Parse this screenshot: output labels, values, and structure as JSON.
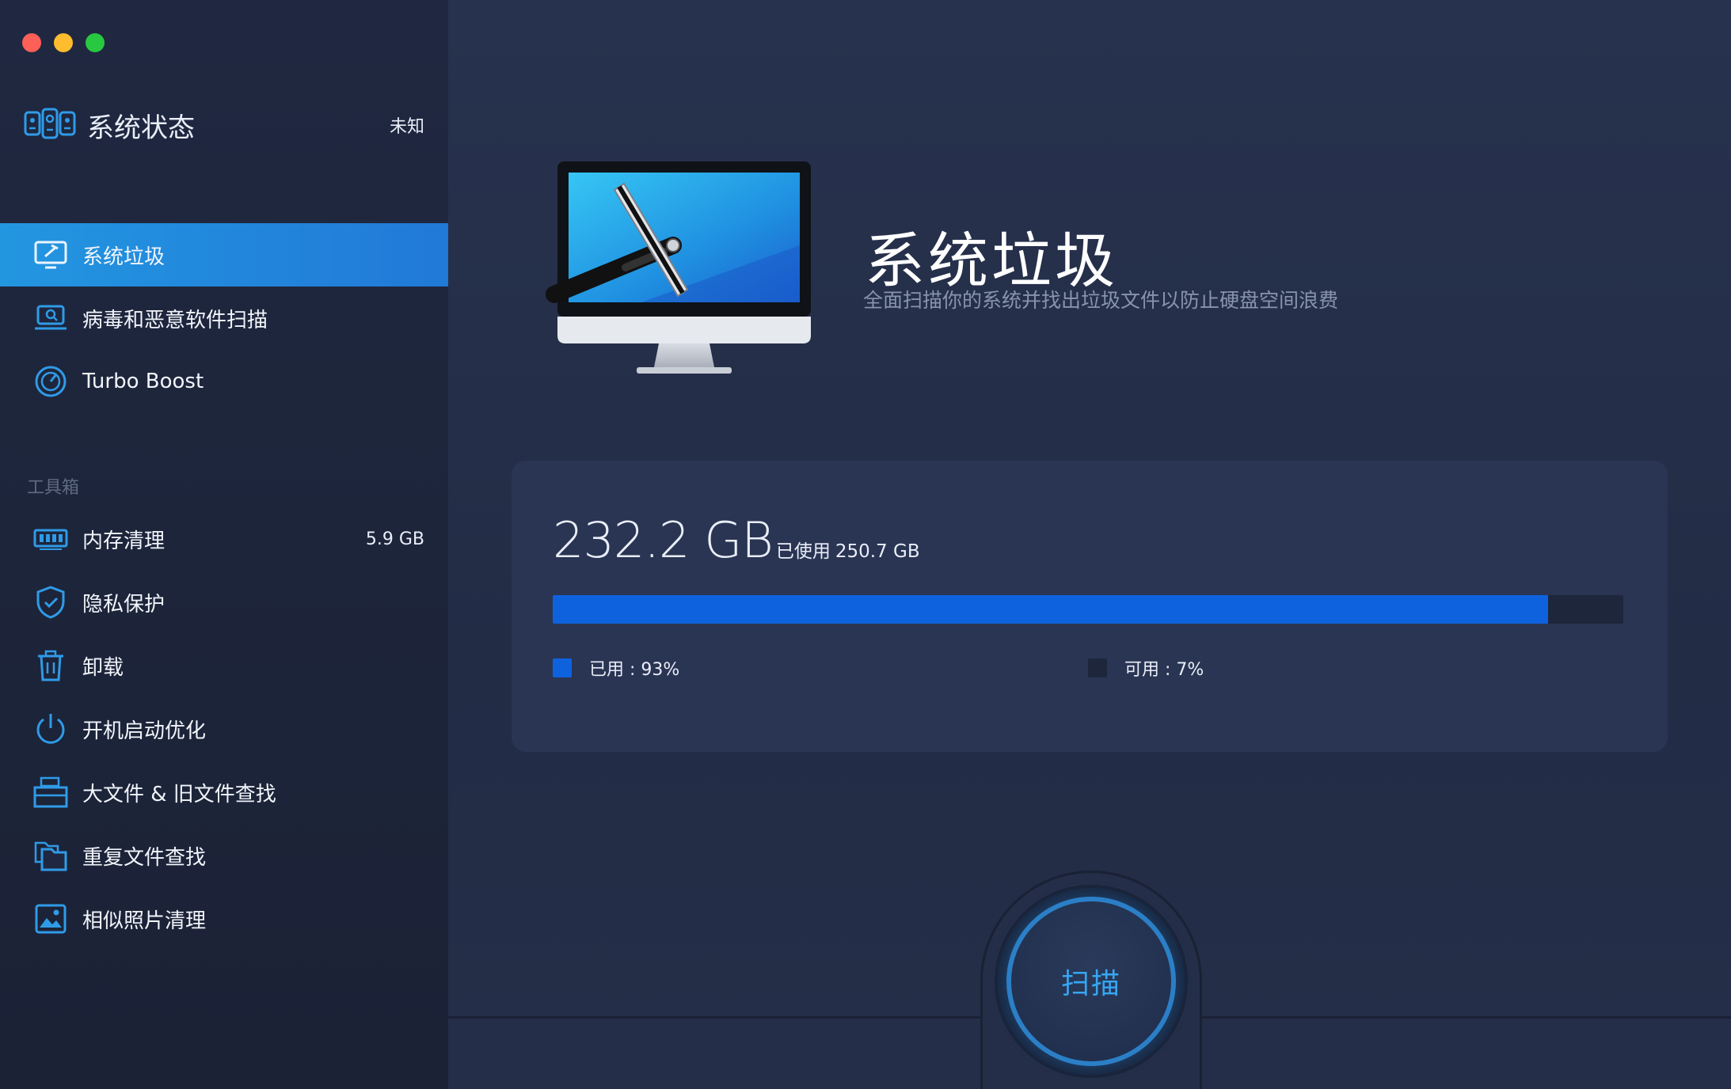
{
  "sidebar": {
    "status": {
      "title": "系统状态",
      "value": "未知"
    },
    "primary_items": [
      {
        "label": "系统垃圾",
        "active": true
      },
      {
        "label": "病毒和恶意软件扫描",
        "active": false
      },
      {
        "label": "Turbo Boost",
        "active": false
      }
    ],
    "toolbox_title": "工具箱",
    "tools": [
      {
        "label": "内存清理",
        "badge": "5.9 GB"
      },
      {
        "label": "隐私保护"
      },
      {
        "label": "卸载"
      },
      {
        "label": "开机启动优化"
      },
      {
        "label": "大文件 & 旧文件查找"
      },
      {
        "label": "重复文件查找"
      },
      {
        "label": "相似照片清理"
      }
    ]
  },
  "main": {
    "title": "系统垃圾",
    "subtitle": "全面扫描你的系统并找出垃圾文件以防止硬盘空间浪费",
    "disk": {
      "used_size": "232.2 GB",
      "used_prefix": "已使用",
      "total_size": "250.7 GB",
      "used_fraction": 0.93,
      "legend_used": "已用 : 93%",
      "legend_free": "可用 : 7%"
    },
    "scan_label": "扫描"
  },
  "colors": {
    "accent": "#2396e0",
    "used": "#0e62de",
    "free": "#1e263c",
    "scan": "#37a6f2"
  }
}
